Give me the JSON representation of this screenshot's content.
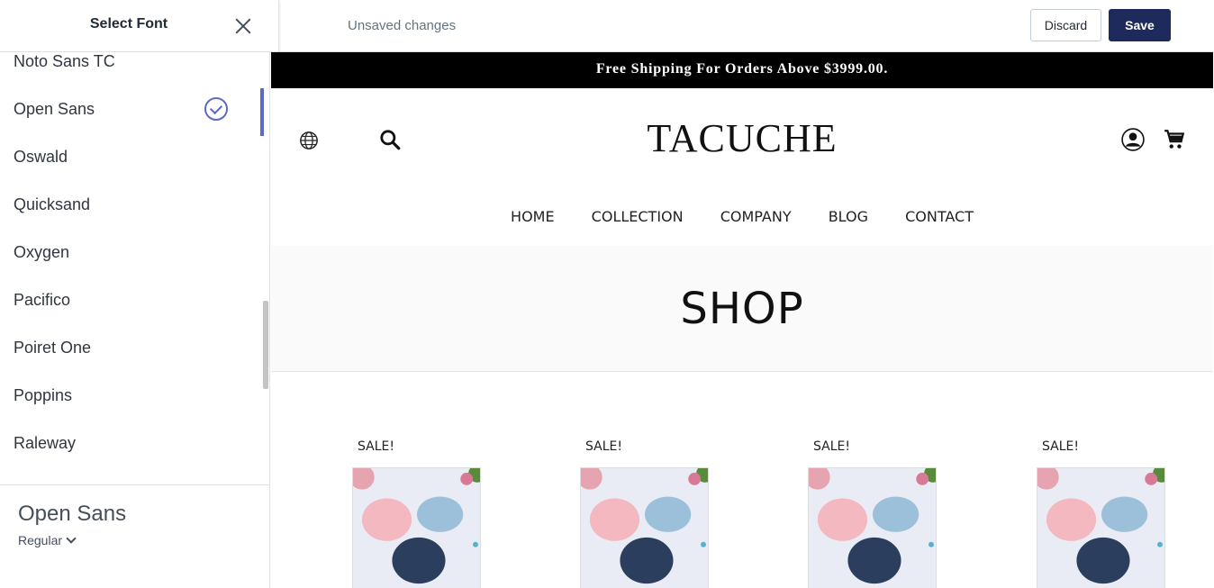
{
  "topbar": {
    "panel_title": "Select Font",
    "status": "Unsaved changes",
    "discard_label": "Discard",
    "save_label": "Save"
  },
  "sidebar": {
    "fonts": [
      "Noto Sans TC",
      "Open Sans",
      "Oswald",
      "Quicksand",
      "Oxygen",
      "Pacifico",
      "Poiret One",
      "Poppins",
      "Raleway"
    ],
    "selected_font": "Open Sans",
    "current_font": "Open Sans",
    "weight": "Regular",
    "accent_color": "#5c6ac4"
  },
  "preview": {
    "announcement": "Free Shipping For Orders Above $3999.00.",
    "logo": "TACUCHE",
    "nav": [
      "HOME",
      "COLLECTION",
      "COMPANY",
      "BLOG",
      "CONTACT"
    ],
    "page_title": "SHOP",
    "products": [
      {
        "badge": "SALE!"
      },
      {
        "badge": "SALE!"
      },
      {
        "badge": "SALE!"
      },
      {
        "badge": "SALE!"
      }
    ]
  }
}
